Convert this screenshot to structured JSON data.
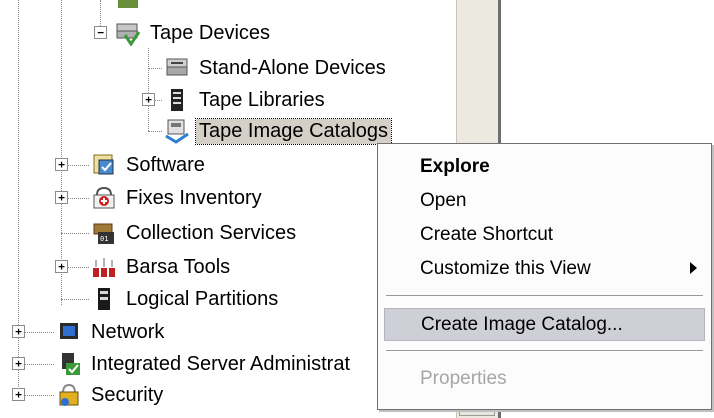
{
  "tree": {
    "nodes": [
      {
        "label": "Tape Devices",
        "icon": "tape-devices-icon",
        "expander": "−"
      },
      {
        "label": "Stand-Alone Devices",
        "icon": "tape-drive-icon",
        "expander": ""
      },
      {
        "label": "Tape Libraries",
        "icon": "tape-library-icon",
        "expander": "+"
      },
      {
        "label": "Tape Image Catalogs",
        "icon": "image-catalog-icon",
        "expander": "",
        "selected": true
      },
      {
        "label": "Software",
        "icon": "software-icon",
        "expander": "+"
      },
      {
        "label": "Fixes Inventory",
        "icon": "fixes-inventory-icon",
        "expander": "+"
      },
      {
        "label": "Collection Services",
        "icon": "collection-services-icon",
        "expander": ""
      },
      {
        "label": "Barsa Tools",
        "icon": "barsa-tools-icon",
        "expander": "+"
      },
      {
        "label": "Logical Partitions",
        "icon": "logical-partitions-icon",
        "expander": ""
      },
      {
        "label": "Network",
        "icon": "network-icon",
        "expander": "+"
      },
      {
        "label": "Integrated Server Administrat",
        "icon": "integrated-server-icon",
        "expander": "+"
      },
      {
        "label": "Security",
        "icon": "security-icon",
        "expander": "+"
      }
    ]
  },
  "scrollbar": {
    "down_arrow": "▼"
  },
  "context_menu": {
    "items": [
      {
        "label": "Explore",
        "default": true
      },
      {
        "label": "Open"
      },
      {
        "label": "Create Shortcut"
      },
      {
        "label": "Customize this View",
        "submenu": true
      },
      {
        "label": "Create Image Catalog...",
        "highlighted": true
      },
      {
        "label": "Properties",
        "disabled": true
      }
    ]
  },
  "colors": {
    "selection": "#d4d0c8",
    "menu_highlight": "#cfcfd8",
    "disabled_text": "#a6a6a6"
  }
}
